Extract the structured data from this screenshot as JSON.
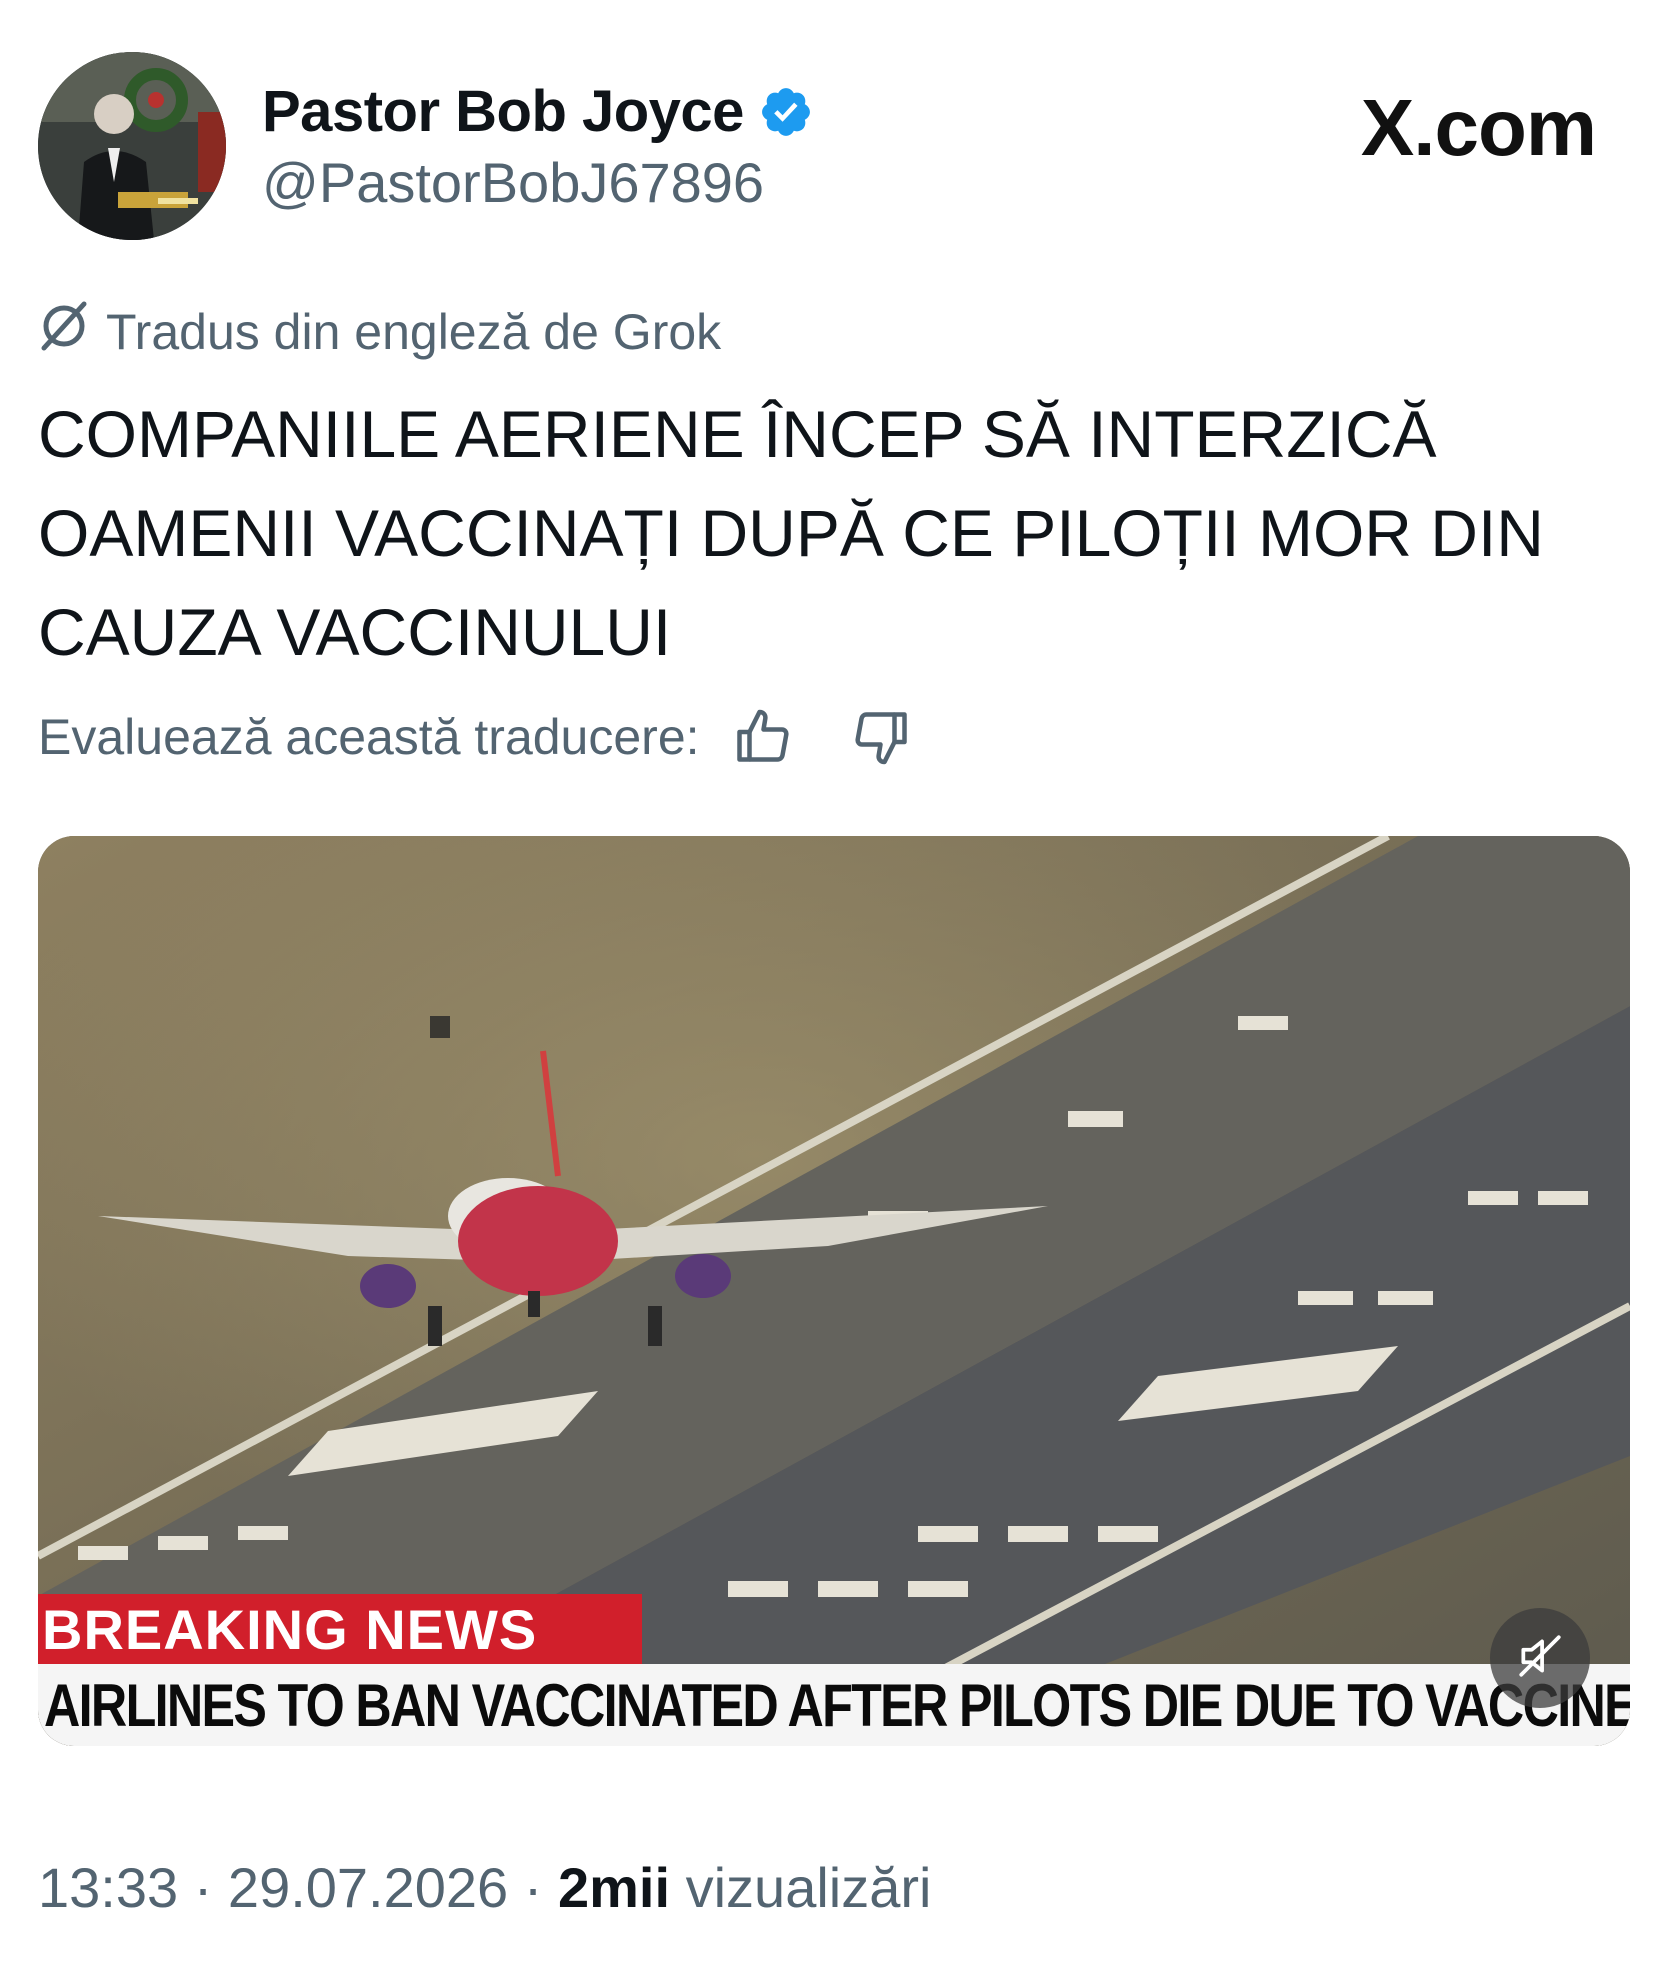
{
  "author": {
    "display_name": "Pastor Bob Joyce",
    "handle": "@PastorBobJ67896",
    "verified": true
  },
  "brand": "X.com",
  "translation": {
    "notice": "Tradus din engleză de Grok",
    "rate_prompt": "Evaluează această traducere:"
  },
  "post": {
    "text": "COMPANIILE AERIENE ÎNCEP SĂ INTERZICĂ OAMENII VACCINAȚI DUPĂ CE PILOȚII MOR DIN CAUZA VACCINULUI"
  },
  "media": {
    "badge": "BREAKING NEWS",
    "ticker": "AIRLINES TO BAN VACCINATED AFTER PILOTS DIE DUE TO VACCINE"
  },
  "meta": {
    "time": "13:33",
    "date": "29.07.2026",
    "views_count": "2mii",
    "views_label": "vizualizări",
    "separator": "·"
  },
  "colors": {
    "verified": "#1d9bf0",
    "muted_text": "#536471",
    "breaking_red": "#d11f2b"
  },
  "icons": [
    "verified-badge-icon",
    "grok-icon",
    "thumbs-up-icon",
    "thumbs-down-icon",
    "muted-speaker-icon"
  ]
}
